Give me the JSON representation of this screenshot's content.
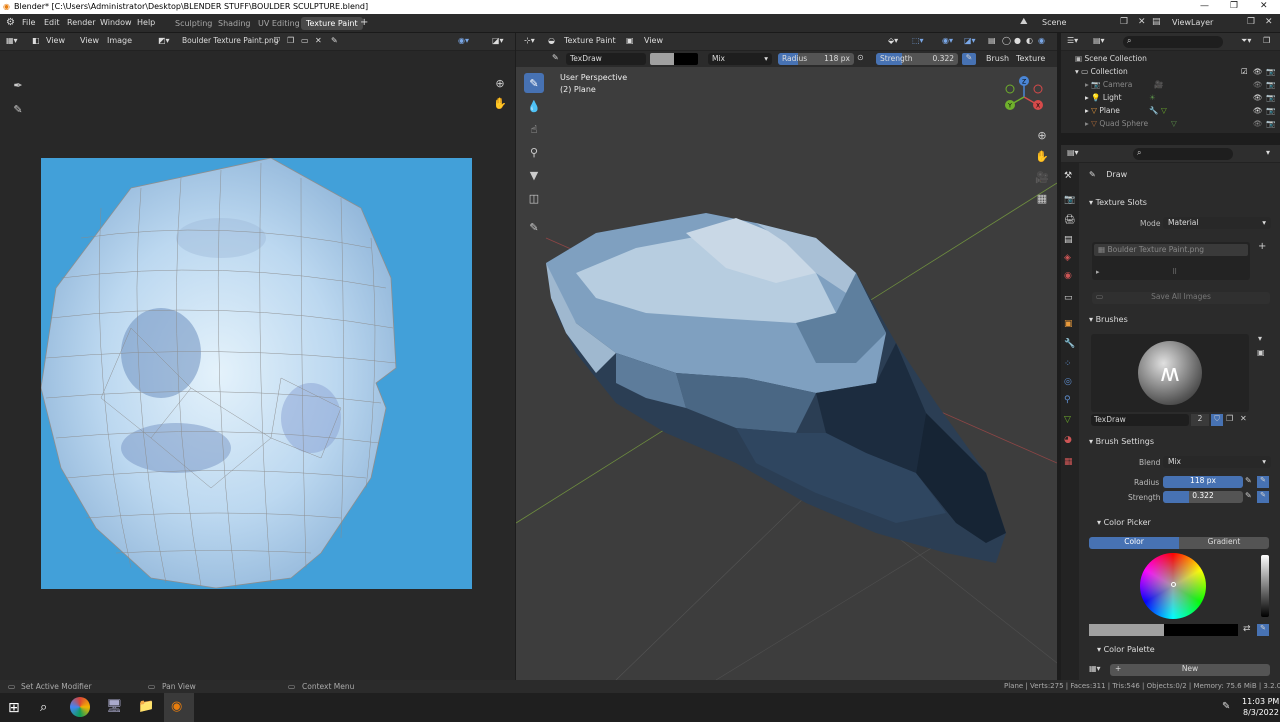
{
  "window": {
    "title": "Blender* [C:\\Users\\Administrator\\Desktop\\BLENDER STUFF\\BOULDER SCULPTURE.blend]"
  },
  "menu": {
    "items": [
      "File",
      "Edit",
      "Render",
      "Window",
      "Help"
    ],
    "workspaces": [
      "Sculpting",
      "Shading",
      "UV Editing",
      "Texture Paint"
    ],
    "active_workspace": "Texture Paint",
    "scene": "Scene",
    "view_layer": "ViewLayer"
  },
  "image_editor": {
    "view_label": "View",
    "view_menu": "View",
    "image_menu": "Image",
    "image_name": "Boulder Texture Paint.png"
  },
  "viewport": {
    "mode": "Texture Paint",
    "view_menu": "View",
    "brush_name": "TexDraw",
    "blend": "Mix",
    "radius_label": "Radius",
    "radius_value": "118 px",
    "strength_label": "Strength",
    "strength_value": "0.322",
    "brush_menu": "Brush",
    "texture_menu": "Texture",
    "overlay_line1": "User Perspective",
    "overlay_line2": "(2) Plane",
    "gizmo_x": "X",
    "gizmo_y": "Y",
    "gizmo_z": "Z"
  },
  "outliner": {
    "root": "Scene Collection",
    "collection": "Collection",
    "items": [
      "Camera",
      "Light",
      "Plane",
      "Quad Sphere"
    ]
  },
  "properties": {
    "tool_name": "Draw",
    "texture_slots": {
      "header": "Texture Slots",
      "mode_label": "Mode",
      "mode_value": "Material",
      "slot_name": "Boulder Texture Paint.png",
      "save_all": "Save All Images"
    },
    "brushes": {
      "header": "Brushes",
      "brush_name": "TexDraw",
      "user_count": "2"
    },
    "brush_settings": {
      "header": "Brush Settings",
      "blend_label": "Blend",
      "blend_value": "Mix",
      "radius_label": "Radius",
      "radius_value": "118 px",
      "strength_label": "Strength",
      "strength_value": "0.322"
    },
    "color_picker": {
      "header": "Color Picker",
      "tab_color": "Color",
      "tab_gradient": "Gradient"
    },
    "color_palette": {
      "header": "Color Palette",
      "new_label": "New"
    }
  },
  "statusbar": {
    "left": "Set Active Modifier",
    "mid": "Pan View",
    "right": "Context Menu",
    "stats": "Plane | Verts:275 | Faces:311 | Tris:546 | Objects:0/2 | Memory: 75.6 MiB | 3.2.0"
  },
  "taskbar": {
    "time": "11:03 PM",
    "date": "8/3/2022"
  },
  "colors": {
    "accent": "#4772b3",
    "viewport_bg": "#3d3d3d",
    "image_bg": "#42a0d9"
  }
}
